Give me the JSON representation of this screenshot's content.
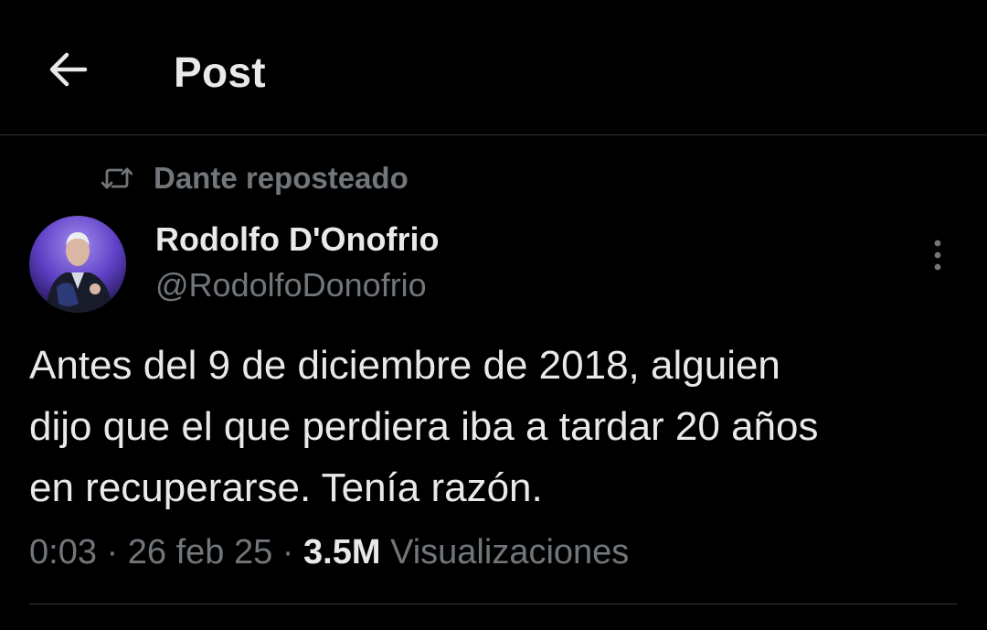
{
  "header": {
    "title": "Post",
    "back_icon": "arrow-left-icon"
  },
  "repost": {
    "icon": "repost-icon",
    "label": "Dante reposteado"
  },
  "author": {
    "name": "Rodolfo D'Onofrio",
    "handle": "@RodolfoDonofrio",
    "avatar_icon": "avatar-photo"
  },
  "more_icon": "more-vertical-icon",
  "tweet": {
    "text_line1": "Antes del 9 de diciembre de 2018, alguien",
    "text_line2": "dijo que el que perdiera iba a tardar 20 años",
    "text_line3": "en recuperarse. Tenía razón."
  },
  "meta": {
    "time": "0:03",
    "separator": "·",
    "date": "26 feb 25",
    "views_count": "3.5M",
    "views_label": "Visualizaciones"
  },
  "colors": {
    "background": "#000000",
    "primary_text": "#e7e9ea",
    "secondary_text": "#71767b",
    "border": "#2f3336"
  }
}
